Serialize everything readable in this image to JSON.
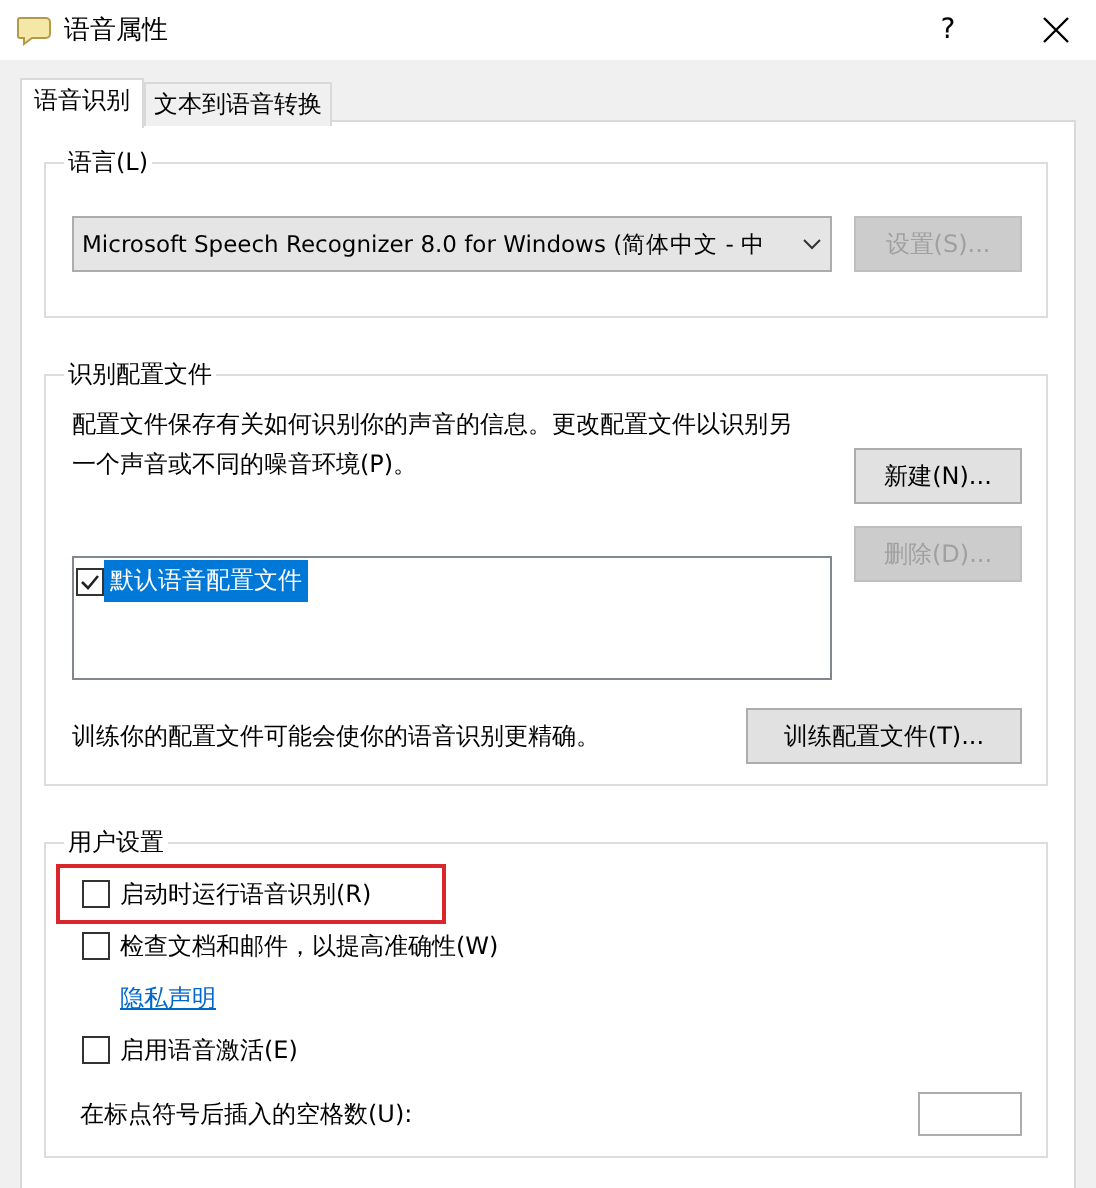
{
  "window": {
    "title": "语音属性",
    "help": "?"
  },
  "tabs": [
    {
      "label": "语音识别",
      "selected": true
    },
    {
      "label": "文本到语音转换",
      "selected": false
    }
  ],
  "language_group": {
    "title": "语言(L)",
    "dropdown": {
      "value": "Microsoft Speech Recognizer 8.0 for Windows (简体中文 - 中"
    },
    "settings_button": {
      "label": "设置(S)...",
      "disabled": true
    }
  },
  "profiles_group": {
    "title": "识别配置文件",
    "description": "配置文件保存有关如何识别你的声音的信息。更改配置文件以识别另一个声音或不同的噪音环境(P)。",
    "buttons": [
      {
        "label": "新建(N)...",
        "disabled": false
      },
      {
        "label": "删除(D)...",
        "disabled": true
      }
    ],
    "profiles": [
      {
        "label": "默认语音配置文件",
        "checked": true,
        "selected": true
      }
    ],
    "train_text": "训练你的配置文件可能会使你的语音识别更精确。",
    "train_button": "训练配置文件(T)..."
  },
  "user_group": {
    "title": "用户设置",
    "options": [
      {
        "kind": "checkbox",
        "label": "启动时运行语音识别(R)",
        "checked": false,
        "highlighted": true
      },
      {
        "kind": "checkbox",
        "label": "检查文档和邮件，以提高准确性(W)",
        "checked": false,
        "highlighted": false
      },
      {
        "kind": "link",
        "label": "隐私声明"
      },
      {
        "kind": "checkbox",
        "label": "启用语音激活(E)",
        "checked": false,
        "highlighted": false
      }
    ],
    "spaces_label": "在标点符号后插入的空格数(U):"
  }
}
